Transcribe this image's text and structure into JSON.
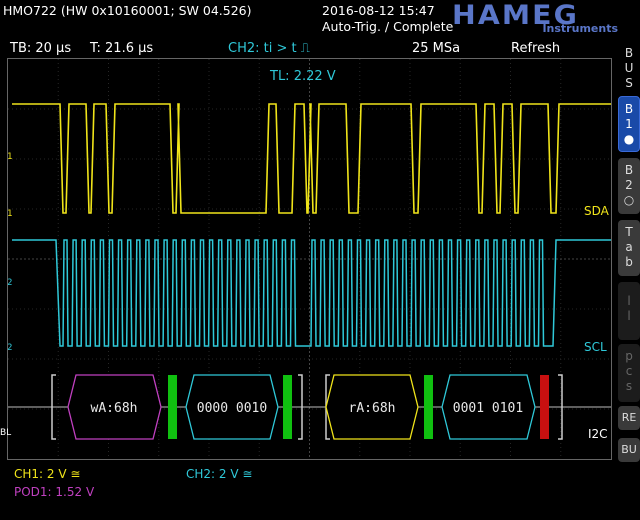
{
  "header": {
    "device": "HMO722 (HW 0x10160001; SW 04.526)",
    "datetime": "2016-08-12 15:47",
    "mode": "Auto-Trig. / Complete",
    "brand": "HAMEG",
    "brand_sub": "Instruments"
  },
  "status": {
    "timebase": "TB: 20 µs",
    "trigger_time": "T: 21.6 µs",
    "trigger": "CH2: ti > t ⎍",
    "sample_rate": "25 MSa",
    "refresh": "Refresh"
  },
  "trigger_level": "TL:  2.22 V",
  "traces": {
    "sda_label": "SDA",
    "scl_label": "SCL",
    "bus_label": "I2C",
    "bl_label": "BL"
  },
  "decode": {
    "frames": [
      "wA:68h",
      "0000  0010",
      "rA:68h",
      "0001  0101"
    ]
  },
  "sidebar": {
    "bus": "B\nU\nS",
    "b1": "B\n1\n●",
    "b2": "B\n2\n○",
    "table": "T\na\nb",
    "lines": "l\nl",
    "pcs": "p\nc\ns",
    "re": "RE",
    "bu": "BU"
  },
  "footer": {
    "ch1": "CH1:  2 V ≅",
    "ch2": "CH2:  2 V ≅",
    "pod1": "POD1:  1.52 V"
  },
  "colors": {
    "ch1": "#f0e41a",
    "ch2": "#2fc8d8",
    "pod": "#c040c0",
    "ack": "#10c010",
    "nack": "#c81010",
    "accent": "#1a4aa8"
  }
}
